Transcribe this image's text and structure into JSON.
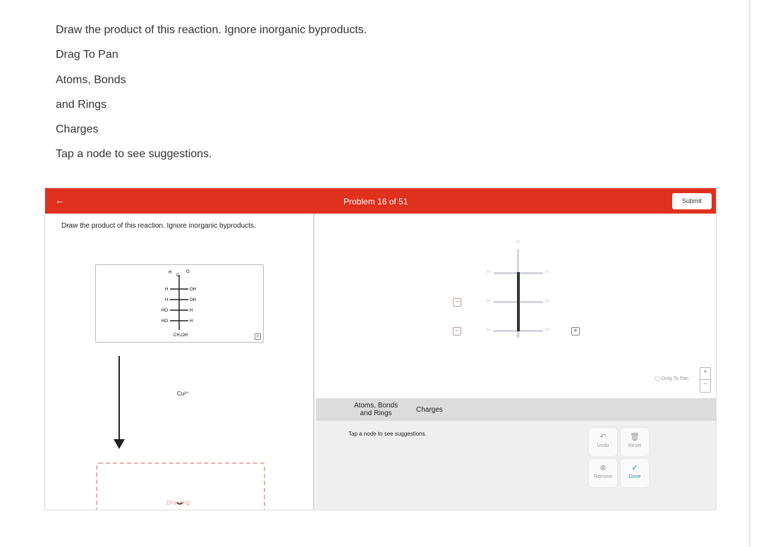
{
  "instructions": [
    "Draw the product of this reaction. Ignore inorganic byproducts.",
    "Drag To Pan",
    "Atoms, Bonds",
    "and Rings",
    "Charges",
    "Tap a node to see suggestions."
  ],
  "header": {
    "back_icon": "arrow-left-icon",
    "title": "Problem 16 of 51",
    "submit": "Submit",
    "color": "#e0301e"
  },
  "question": "Draw the product of this reaction. Ignore inorganic byproducts.",
  "molecule": {
    "top": [
      "H",
      "C",
      "O"
    ],
    "rows": [
      [
        "H",
        "OH"
      ],
      [
        "H",
        "OH"
      ],
      [
        "HO",
        "H"
      ],
      [
        "HO",
        "H"
      ]
    ],
    "bottom": "CH₂OH"
  },
  "reagent": "Cu²⁺",
  "drop_zone": {
    "label": "Drawing"
  },
  "canvas": {
    "h": "H"
  },
  "tabs": {
    "atoms": "Atoms, Bonds and Rings",
    "charges": "Charges"
  },
  "hint": "Tap a node to see suggestions.",
  "drag_to_pan": "Drag To Pan",
  "zoom": {
    "plus": "+",
    "minus": "−"
  },
  "actions": {
    "undo": "Undo",
    "reset": "Reset",
    "remove": "Remove",
    "done": "Done"
  }
}
